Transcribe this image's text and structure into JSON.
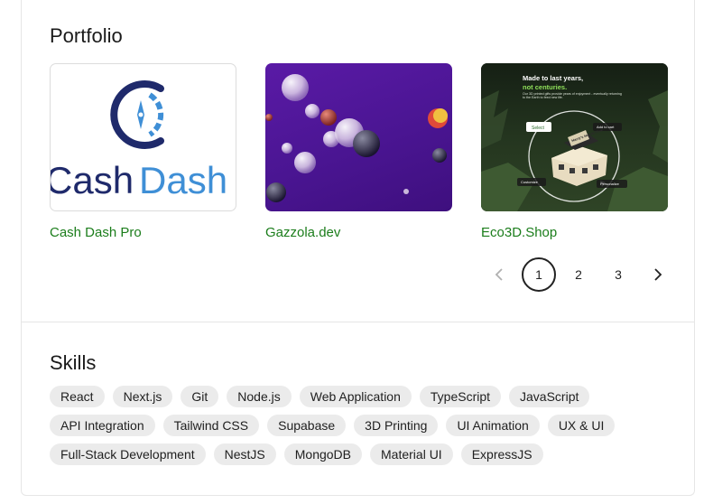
{
  "portfolio": {
    "title": "Portfolio",
    "projects": [
      {
        "name": "Cash Dash Pro",
        "logo_text_1": "Cash",
        "logo_text_2": "Dash"
      },
      {
        "name": "Gazzola.dev"
      },
      {
        "name": "Eco3D.Shop",
        "headline_1": "Made to last years,",
        "headline_2": "not centuries.",
        "blurb": "Our 3D printed gifts provide years of enjoyment - eventually returning to the Earth to feed new life.",
        "chip_select": "Select",
        "chip_add": "Add to cart",
        "chip_customize": "Customize",
        "chip_personalize": "Personalize",
        "sign_text": "Harry's Honey Hive"
      }
    ],
    "pagination": {
      "prev_icon": "chevron-left-icon",
      "next_icon": "chevron-right-icon",
      "pages": [
        "1",
        "2",
        "3"
      ],
      "current": "1"
    }
  },
  "skills": {
    "title": "Skills",
    "rows": [
      [
        "React",
        "Next.js",
        "Git",
        "Node.js",
        "Web Application",
        "TypeScript",
        "JavaScript"
      ],
      [
        "API Integration",
        "Tailwind CSS",
        "Supabase",
        "3D Printing",
        "UI Animation",
        "UX & UI"
      ],
      [
        "Full-Stack Development",
        "NestJS",
        "MongoDB",
        "Material UI",
        "ExpressJS"
      ]
    ]
  },
  "colors": {
    "link_green": "#1b7d1b",
    "navy": "#1f2a6b",
    "sky": "#3f8fd6",
    "purple": "#4a1592",
    "chip_bg": "#ebebeb"
  }
}
